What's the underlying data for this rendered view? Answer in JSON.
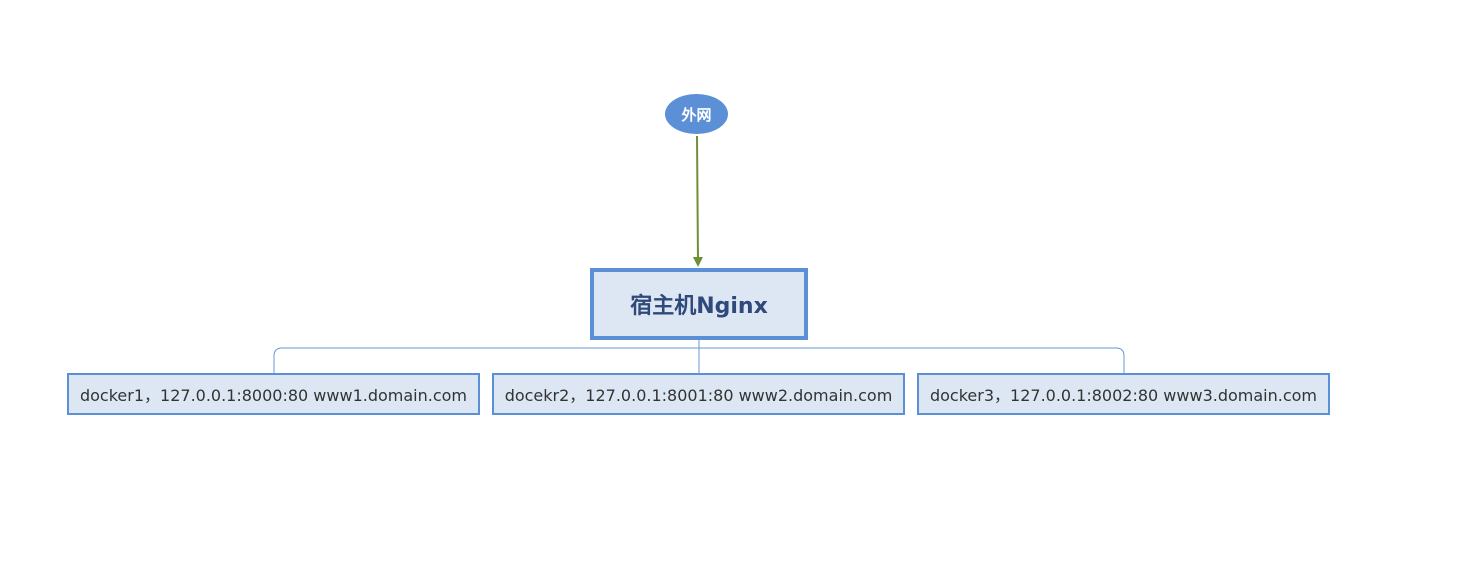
{
  "diagram": {
    "root": {
      "label": "外网"
    },
    "host": {
      "label": "宿主机Nginx"
    },
    "children": [
      {
        "label": "docker1，127.0.0.1:8000:80 www1.domain.com"
      },
      {
        "label": "docekr2，127.0.0.1:8001:80 www2.domain.com"
      },
      {
        "label": "docker3，127.0.0.1:8002:80 www3.domain.com"
      }
    ],
    "colors": {
      "node_fill": "#dde6f3",
      "node_border": "#5b8fd6",
      "root_fill": "#5b8fd6",
      "arrow": "#6f8f3a",
      "connector": "#6a97d4"
    }
  }
}
